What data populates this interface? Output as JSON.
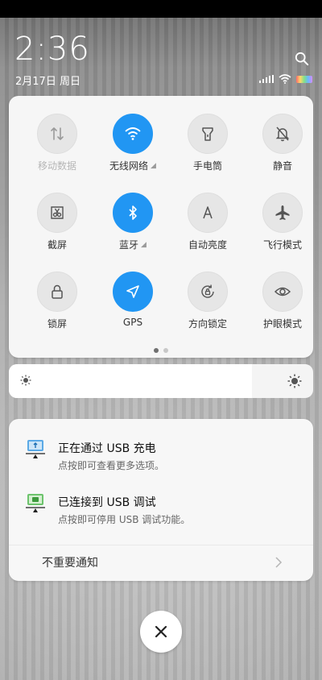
{
  "status": {
    "time": "2:36",
    "date": "2月17日 周日"
  },
  "quick_settings": {
    "tiles": [
      {
        "label": "移动数据",
        "icon": "mobile-data-icon",
        "active": false,
        "dim": true,
        "arrow": false
      },
      {
        "label": "无线网络",
        "icon": "wifi-icon",
        "active": true,
        "dim": false,
        "arrow": true
      },
      {
        "label": "手电筒",
        "icon": "flashlight-icon",
        "active": false,
        "dim": false,
        "arrow": false
      },
      {
        "label": "静音",
        "icon": "mute-bell-icon",
        "active": false,
        "dim": false,
        "arrow": false
      },
      {
        "label": "截屏",
        "icon": "screenshot-icon",
        "active": false,
        "dim": false,
        "arrow": false
      },
      {
        "label": "蓝牙",
        "icon": "bluetooth-icon",
        "active": true,
        "dim": false,
        "arrow": true
      },
      {
        "label": "自动亮度",
        "icon": "auto-brightness-icon",
        "active": false,
        "dim": false,
        "arrow": false
      },
      {
        "label": "飞行模式",
        "icon": "airplane-icon",
        "active": false,
        "dim": false,
        "arrow": false
      },
      {
        "label": "锁屏",
        "icon": "lock-icon",
        "active": false,
        "dim": false,
        "arrow": false
      },
      {
        "label": "GPS",
        "icon": "gps-icon",
        "active": true,
        "dim": false,
        "arrow": false
      },
      {
        "label": "方向锁定",
        "icon": "rotation-lock-icon",
        "active": false,
        "dim": false,
        "arrow": false
      },
      {
        "label": "护眼模式",
        "icon": "eye-icon",
        "active": false,
        "dim": false,
        "arrow": false
      }
    ],
    "page_count": 2,
    "current_page": 1
  },
  "brightness": {
    "level": 0.8
  },
  "notifications": {
    "items": [
      {
        "title": "正在通过 USB 充电",
        "subtitle": "点按即可查看更多选项。",
        "icon": "usb-charging-icon"
      },
      {
        "title": "已连接到 USB 调试",
        "subtitle": "点按即可停用 USB 调试功能。",
        "icon": "usb-debug-icon"
      }
    ],
    "unimportant_label": "不重要通知"
  },
  "colors": {
    "accent": "#2196f3"
  }
}
